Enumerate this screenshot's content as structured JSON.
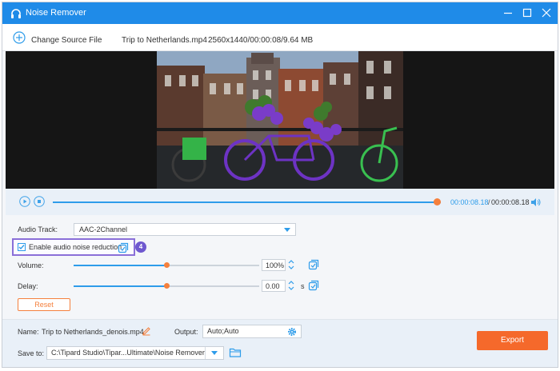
{
  "window": {
    "title": "Noise Remover",
    "accent_color": "#1f8be8",
    "highlight_color": "#8a6fd8",
    "action_color": "#f5692b"
  },
  "toolbar": {
    "change_source_label": "Change Source File",
    "file_name": "Trip to Netherlands.mp4",
    "file_info": "2560x1440/00:00:08/9.64 MB"
  },
  "player": {
    "progress_fraction": 0.99,
    "current_time": "00:00:08.18",
    "separator": "/",
    "total_time": "00:00:08.18"
  },
  "settings": {
    "audio_track_label": "Audio Track:",
    "audio_track_value": "AAC-2Channel",
    "noise_reduction_label": "Enable audio noise reduction",
    "noise_reduction_checked": true,
    "step_badge": "4",
    "volume_label": "Volume:",
    "volume_value": "100%",
    "volume_fraction": 0.5,
    "delay_label": "Delay:",
    "delay_value": "0.00",
    "delay_unit": "s",
    "delay_fraction": 0.5,
    "reset_label": "Reset"
  },
  "output": {
    "name_label": "Name:",
    "name_value": "Trip to Netherlands_denois.mp4",
    "output_label": "Output:",
    "output_value": "Auto;Auto",
    "save_to_label": "Save to:",
    "save_path": "C:\\Tipard Studio\\Tipar...Ultimate\\Noise Remover",
    "export_label": "Export"
  },
  "icons": [
    "headphones-icon",
    "minimize-icon",
    "maximize-icon",
    "close-icon",
    "add-circle-icon",
    "play-icon",
    "stop-icon",
    "volume-icon",
    "copy-settings-icon",
    "edit-pencil-icon",
    "gear-icon",
    "folder-icon"
  ]
}
